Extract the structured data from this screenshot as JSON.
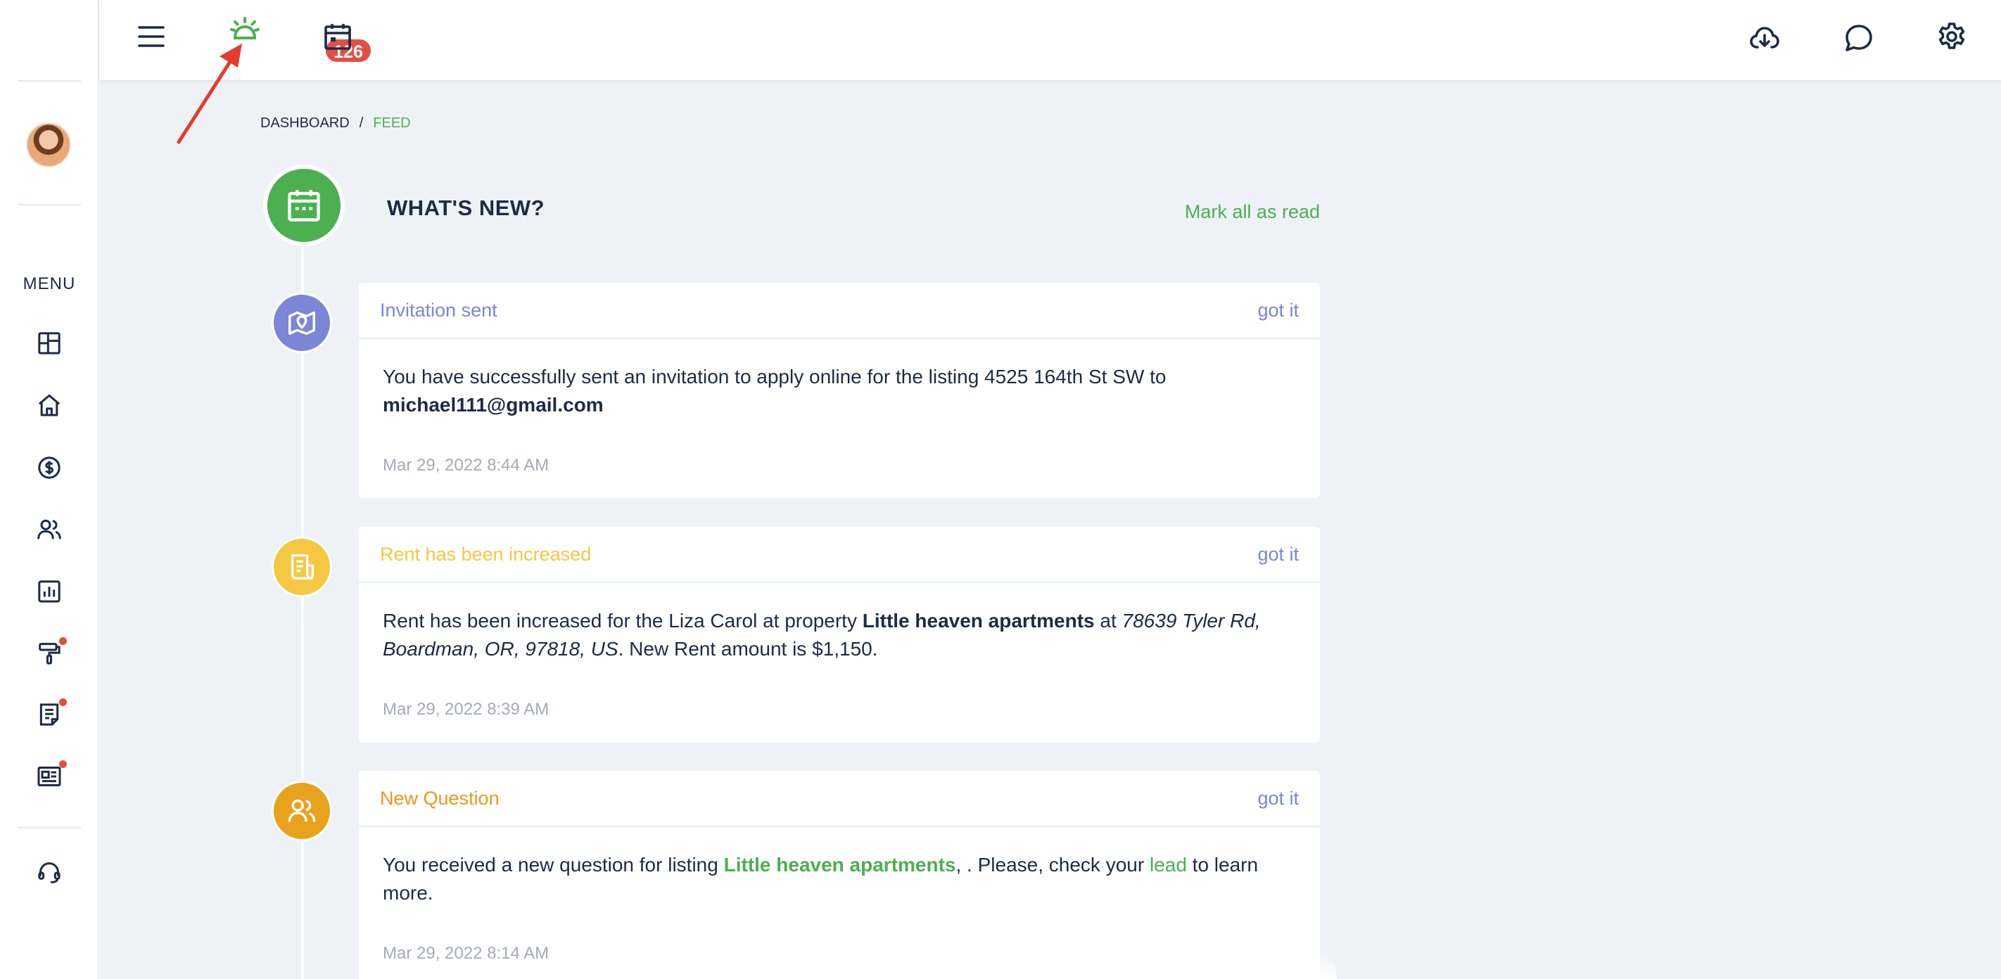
{
  "topbar": {
    "notification_count": "126",
    "icons": [
      "menu-icon",
      "alarm-bell-icon",
      "calendar-icon",
      "cloud-download-icon",
      "chat-bubble-icon",
      "gear-icon"
    ]
  },
  "sidebar": {
    "menu_label": "MENU",
    "items": [
      {
        "name": "dashboard",
        "icon": "dashboard-grid-icon",
        "dot": false
      },
      {
        "name": "properties",
        "icon": "home-icon",
        "dot": false
      },
      {
        "name": "payments",
        "icon": "dollar-circle-icon",
        "dot": false
      },
      {
        "name": "people",
        "icon": "users-icon",
        "dot": false
      },
      {
        "name": "reports",
        "icon": "bar-chart-icon",
        "dot": false
      },
      {
        "name": "maintenance",
        "icon": "paint-roller-icon",
        "dot": true
      },
      {
        "name": "documents",
        "icon": "document-icon",
        "dot": true
      },
      {
        "name": "listings",
        "icon": "newspaper-icon",
        "dot": true
      },
      {
        "name": "support",
        "icon": "headset-icon",
        "dot": false
      }
    ]
  },
  "breadcrumb": {
    "home": "DASHBOARD",
    "separator": "/",
    "current": "FEED"
  },
  "feed": {
    "title": "WHAT'S NEW?",
    "mark_all_label": "Mark all as read",
    "items": [
      {
        "title": "Invitation sent",
        "title_color": "#7b86d6",
        "icon": "map-pin-icon",
        "icon_bg": "#7b86d6",
        "action": "got it",
        "text1": "You have successfully sent an invitation to apply online for the listing 4525 164th St SW to ",
        "email": "michael111@gmail.com",
        "time": "Mar 29, 2022 8:44 AM"
      },
      {
        "title": "Rent has been increased",
        "title_color": "#f5c842",
        "icon": "receipt-icon",
        "icon_bg": "#f5c842",
        "action": "got it",
        "text1": "Rent has been increased for the Liza Carol at property ",
        "property": "Little heaven apartments",
        "text2": " at ",
        "address": "78639 Tyler Rd, Boardman, OR, 97818, US",
        "text3": ". New Rent amount is $1,150.",
        "time": "Mar 29, 2022 8:39 AM"
      },
      {
        "title": "New Question",
        "title_color": "#e89a1a",
        "icon": "users-icon",
        "icon_bg": "#e8a21c",
        "action": "got it",
        "text1": "You received a new question for listing ",
        "listing": "Little heaven apartments",
        "text2": ", . Please, check your ",
        "lead": "lead",
        "text3": " to learn more.",
        "time": "Mar 29, 2022 8:14 AM"
      }
    ]
  },
  "colors": {
    "accent_green": "#4caf50",
    "badge_red": "#e05043",
    "navy": "#1d2b44",
    "background": "#eef2f7"
  }
}
